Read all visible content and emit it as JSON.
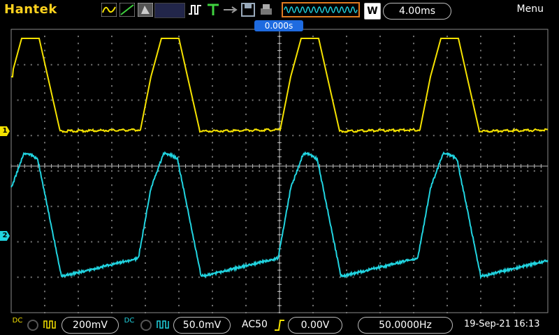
{
  "brand": "Hantek",
  "header": {
    "timebase_mode": "W",
    "timebase": "4.00ms",
    "trigger_time": "0.000s",
    "menu_label": "Menu"
  },
  "channels": [
    {
      "id": "1",
      "color": "#f5e200",
      "coupling": "DC",
      "scale": "200mV"
    },
    {
      "id": "2",
      "color": "#21d4e0",
      "coupling": "DC",
      "scale": "50.0mV"
    }
  ],
  "trigger": {
    "mode": "AC50",
    "level": "0.00V",
    "frequency": "50.0000Hz"
  },
  "status": {
    "date_time": "19-Sep-21 16:13"
  },
  "icons": [
    "math-wave-icon",
    "ref-ramp-icon",
    "cursor-icon",
    "run-pulse-icon",
    "trigger-T-icon",
    "usb-icon",
    "save-icon",
    "print-icon",
    "waveform-preview-icon"
  ],
  "colors": {
    "accent": "#1e6be0",
    "bg": "#000000",
    "grid": "#7a7a7a",
    "ch1": "#f5e200",
    "ch2": "#21d4e0"
  }
}
